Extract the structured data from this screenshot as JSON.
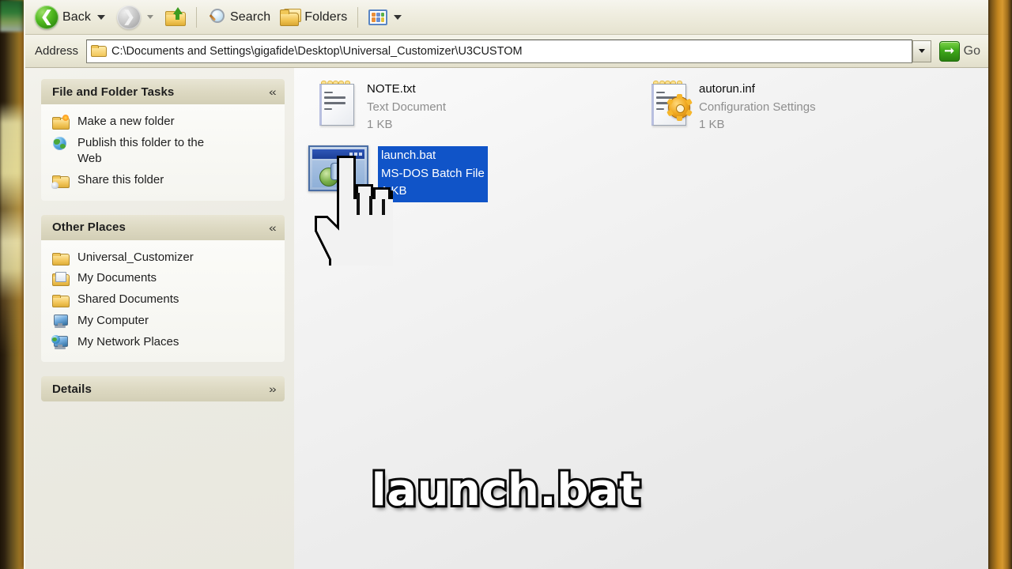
{
  "window": {
    "toolbar": {
      "back_label": "Back",
      "forward_label": "",
      "up_label": "",
      "search_label": "Search",
      "folders_label": "Folders",
      "views_label": ""
    },
    "address": {
      "label": "Address",
      "value": "C:\\Documents and Settings\\gigafide\\Desktop\\Universal_Customizer\\U3CUSTOM",
      "go_label": "Go"
    }
  },
  "sidebar": {
    "panels": [
      {
        "title": "File and Folder Tasks",
        "collapse_glyph": "«",
        "collapsed": false,
        "items": [
          {
            "label": "Make a new folder",
            "icon": "new-folder-icon"
          },
          {
            "label": "Publish this folder to the Web",
            "icon": "publish-web-icon"
          },
          {
            "label": "Share this folder",
            "icon": "share-folder-icon"
          }
        ]
      },
      {
        "title": "Other Places",
        "collapse_glyph": "«",
        "collapsed": false,
        "items": [
          {
            "label": "Universal_Customizer",
            "icon": "folder-icon"
          },
          {
            "label": "My Documents",
            "icon": "my-documents-icon"
          },
          {
            "label": "Shared Documents",
            "icon": "shared-documents-icon"
          },
          {
            "label": "My Computer",
            "icon": "my-computer-icon"
          },
          {
            "label": "My Network Places",
            "icon": "my-network-places-icon"
          }
        ]
      },
      {
        "title": "Details",
        "collapse_glyph": "»",
        "collapsed": true,
        "items": []
      }
    ]
  },
  "files": [
    {
      "name": "NOTE.txt",
      "type": "Text Document",
      "size": "1 KB",
      "icon": "text-document-icon",
      "selected": false
    },
    {
      "name": "autorun.inf",
      "type": "Configuration Settings",
      "size": "1 KB",
      "icon": "configuration-settings-icon",
      "selected": false
    },
    {
      "name": "launch.bat",
      "type": "MS-DOS Batch File",
      "size": "1 KB",
      "icon": "ms-dos-batch-file-icon",
      "selected": true
    }
  ],
  "caption": {
    "text": "launch.bat"
  },
  "colors": {
    "selection_blue": "#1054c8",
    "panel_header": "#ddd9c2",
    "sidebar_bg": "#ecebe3",
    "go_green": "#3ea81a",
    "desktop_orange": "#c4861f"
  }
}
